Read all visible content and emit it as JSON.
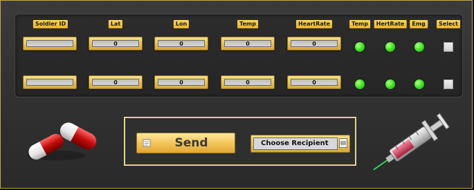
{
  "columns": {
    "soldier_id": "Soldier ID",
    "lat": "Lat",
    "lon": "Lon",
    "temp": "Temp",
    "heart_rate": "HeartRate",
    "temp_status": "Temp",
    "heart_rate_status": "HertRate",
    "emg_status": "Emg",
    "select": "Select"
  },
  "rows": [
    {
      "soldier_id": "",
      "lat": "0",
      "lon": "0",
      "temp": "0",
      "heart_rate": "0",
      "temp_status": "green",
      "heart_rate_status": "green",
      "emg_status": "green",
      "selected": false
    },
    {
      "soldier_id": "",
      "lat": "0",
      "lon": "0",
      "temp": "0",
      "heart_rate": "0",
      "temp_status": "green",
      "heart_rate_status": "green",
      "emg_status": "green",
      "selected": false
    }
  ],
  "actions": {
    "send_label": "Send",
    "recipient_selected": "Choose Recipient"
  },
  "icons": {
    "send": "document-icon",
    "dropdown": "dropdown-arrow-icon",
    "pills": "pills-icon",
    "syringe": "syringe-icon"
  },
  "colors": {
    "accent_gold": "#e9b229",
    "status_green": "#47e82a",
    "background": "#343434"
  }
}
